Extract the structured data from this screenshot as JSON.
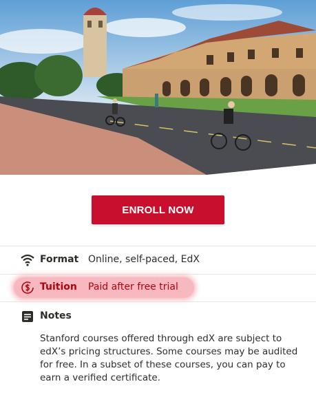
{
  "hero": {
    "alt_icon": "campus-photo"
  },
  "cta": {
    "enroll_label": "ENROLL NOW",
    "color": "#c8102e"
  },
  "details": {
    "format": {
      "icon": "wifi-icon",
      "label": "Format",
      "value": "Online, self-paced, EdX"
    },
    "tuition": {
      "icon": "dollar-clock-icon",
      "label": "Tuition",
      "value": "Paid after free trial",
      "highlight_color": "#f7b8bf"
    },
    "notes": {
      "icon": "notes-icon",
      "label": "Notes",
      "text": "Stanford courses offered through edX are subject to edX’s pricing structures. Some courses may be audited for free. In a subset of these courses, you can pay to earn a verified certificate."
    }
  }
}
